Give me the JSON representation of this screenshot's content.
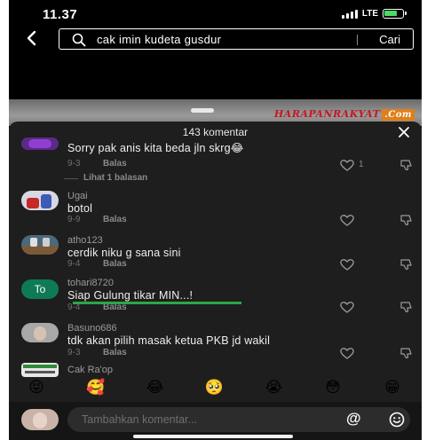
{
  "status_bar": {
    "time": "11.37",
    "network": "LTE"
  },
  "search": {
    "back_icon": "chevron-left-icon",
    "query": "cak imin kudeta gusdur",
    "submit_label": "Cari"
  },
  "watermark": {
    "part1": "HARAPAN",
    "part2": "RAKYAT",
    "part3": ".Com"
  },
  "comments_sheet": {
    "count_label": "143 komentar",
    "close_icon": "close-icon",
    "comments": [
      {
        "user": "",
        "text": "Sorry pak anis kita beda jln skrg😂",
        "date": "9-3",
        "reply_label": "Balas",
        "likes": "1",
        "view_replies": "Lihat 1 balasan"
      },
      {
        "user": "Ugai",
        "text": "botol",
        "date": "9-9",
        "reply_label": "Balas",
        "likes": ""
      },
      {
        "user": "atho123",
        "text": "cerdik niku g sana sini",
        "date": "9-4",
        "reply_label": "Balas",
        "likes": ""
      },
      {
        "user": "tohari8720",
        "text": "Siap Gulung tikar MIN...!",
        "date": "9-4",
        "reply_label": "Balas",
        "likes": "",
        "avatar_text": "To"
      },
      {
        "user": "Basuno686",
        "text": "tdk akan pilih masak ketua PKB jd wakil",
        "date": "9-3",
        "reply_label": "Balas",
        "likes": ""
      },
      {
        "user": "Cak Ra'op",
        "text": "",
        "date": "",
        "reply_label": "",
        "likes": ""
      }
    ],
    "quick_emojis": [
      "😝",
      "🥰",
      "😂",
      "🥺",
      "😭",
      "😳",
      "😁"
    ],
    "input_placeholder": "Tambahkan komentar...",
    "mention_label": "@",
    "emoji_button_icon": "smile-icon"
  }
}
